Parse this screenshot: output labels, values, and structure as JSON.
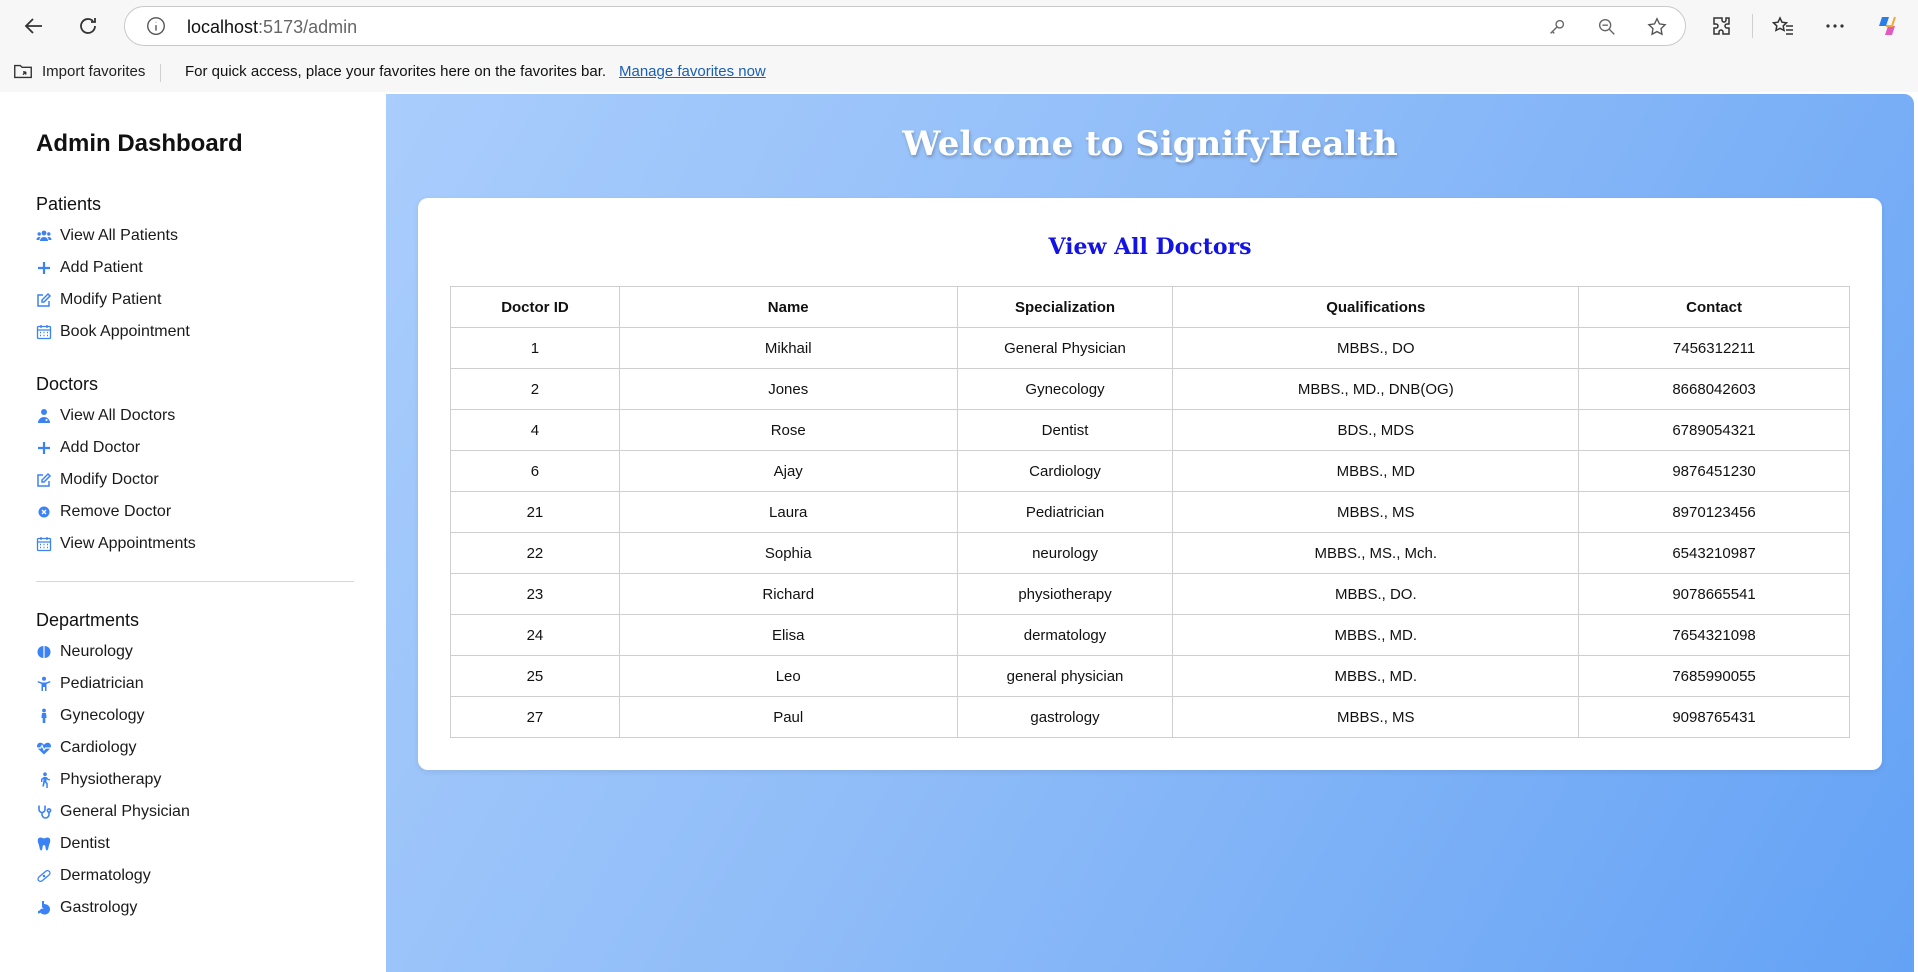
{
  "browser": {
    "url_host": "localhost",
    "url_path": ":5173/admin",
    "favorites": {
      "import_label": "Import favorites",
      "hint_text": "For quick access, place your favorites here on the favorites bar.",
      "manage_link": "Manage favorites now"
    }
  },
  "sidebar": {
    "title": "Admin Dashboard",
    "sections": [
      {
        "heading": "Patients",
        "items": [
          {
            "label": "View All Patients",
            "icon": "users-icon"
          },
          {
            "label": "Add Patient",
            "icon": "plus-icon"
          },
          {
            "label": "Modify Patient",
            "icon": "edit-icon"
          },
          {
            "label": "Book Appointment",
            "icon": "calendar-icon"
          }
        ]
      },
      {
        "heading": "Doctors",
        "items": [
          {
            "label": "View All Doctors",
            "icon": "doctor-icon"
          },
          {
            "label": "Add Doctor",
            "icon": "plus-icon"
          },
          {
            "label": "Modify Doctor",
            "icon": "edit-icon"
          },
          {
            "label": "Remove Doctor",
            "icon": "remove-icon"
          },
          {
            "label": "View Appointments",
            "icon": "calendar-icon"
          }
        ]
      },
      {
        "heading": "Departments",
        "items": [
          {
            "label": "Neurology",
            "icon": "brain-icon"
          },
          {
            "label": "Pediatrician",
            "icon": "child-icon"
          },
          {
            "label": "Gynecology",
            "icon": "person-icon"
          },
          {
            "label": "Cardiology",
            "icon": "heart-pulse-icon"
          },
          {
            "label": "Physiotherapy",
            "icon": "walking-icon"
          },
          {
            "label": "General Physician",
            "icon": "stethoscope-icon"
          },
          {
            "label": "Dentist",
            "icon": "tooth-icon"
          },
          {
            "label": "Dermatology",
            "icon": "bandage-icon"
          },
          {
            "label": "Gastrology",
            "icon": "stomach-icon"
          }
        ]
      }
    ]
  },
  "main": {
    "welcome": "Welcome to SignifyHealth",
    "card_title": "View All Doctors",
    "columns": [
      "Doctor ID",
      "Name",
      "Specialization",
      "Qualifications",
      "Contact"
    ],
    "rows": [
      [
        "1",
        "Mikhail",
        "General Physician",
        "MBBS., DO",
        "7456312211"
      ],
      [
        "2",
        "Jones",
        "Gynecology",
        "MBBS., MD., DNB(OG)",
        "8668042603"
      ],
      [
        "4",
        "Rose",
        "Dentist",
        "BDS., MDS",
        "6789054321"
      ],
      [
        "6",
        "Ajay",
        "Cardiology",
        "MBBS., MD",
        "9876451230"
      ],
      [
        "21",
        "Laura",
        "Pediatrician",
        "MBBS., MS",
        "8970123456"
      ],
      [
        "22",
        "Sophia",
        "neurology",
        "MBBS., MS., Mch.",
        "6543210987"
      ],
      [
        "23",
        "Richard",
        "physiotherapy",
        "MBBS., DO.",
        "9078665541"
      ],
      [
        "24",
        "Elisa",
        "dermatology",
        "MBBS., MD.",
        "7654321098"
      ],
      [
        "25",
        "Leo",
        "general physician",
        "MBBS., MD.",
        "7685990055"
      ],
      [
        "27",
        "Paul",
        "gastrology",
        "MBBS., MS",
        "9098765431"
      ]
    ]
  },
  "colors": {
    "accent": "#3b82f6",
    "card_title": "#1313e6",
    "gradient_start": "#a9cdfc",
    "gradient_end": "#64a2f5"
  }
}
